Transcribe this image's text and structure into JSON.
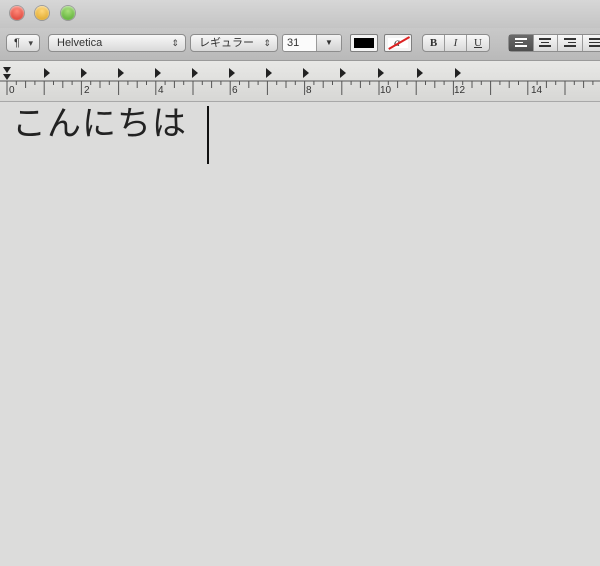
{
  "window": {
    "traffic_lights": [
      "close",
      "minimize",
      "zoom"
    ]
  },
  "toolbar": {
    "paragraph_style_icon": "¶",
    "font_family": "Helvetica",
    "font_style": "レギュラー",
    "font_size": "31",
    "text_color": "#000000",
    "highlight_label": "a",
    "bold_label": "B",
    "italic_label": "I",
    "underline_label": "U",
    "alignment_options": [
      "left",
      "center",
      "right",
      "justify"
    ],
    "alignment_selected": "left"
  },
  "ruler": {
    "numbers": [
      "0",
      "2",
      "4",
      "6",
      "8",
      "10",
      "12",
      "14"
    ]
  },
  "document": {
    "text": "こんにちは"
  }
}
